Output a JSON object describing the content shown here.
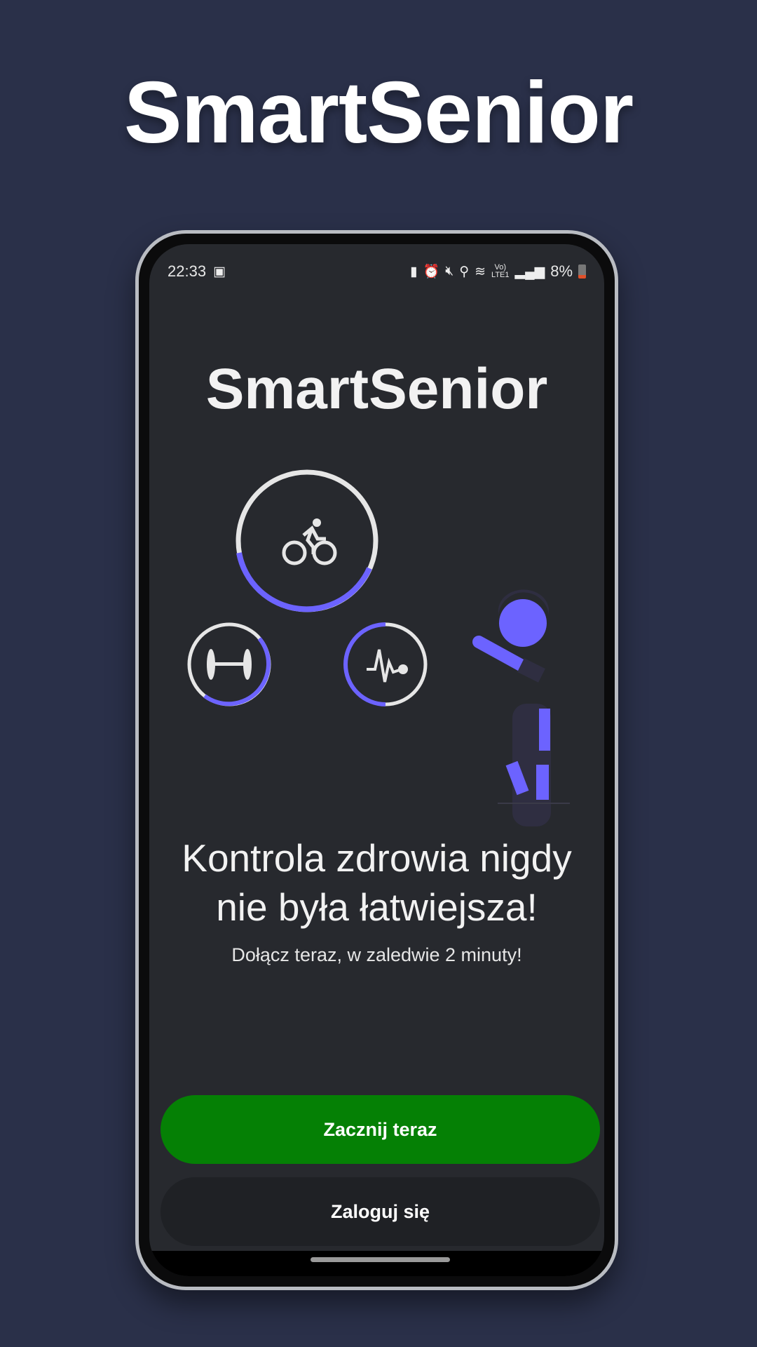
{
  "promo": {
    "title": "SmartSenior"
  },
  "status_bar": {
    "time": "22:33",
    "battery": "8%",
    "network": "LTE1",
    "icons": [
      "gallery-icon",
      "battery-saver-icon",
      "alarm-icon",
      "mute-icon",
      "location-icon",
      "wifi-icon",
      "volte-icon",
      "signal-icon",
      "battery-icon"
    ]
  },
  "app": {
    "title": "SmartSenior",
    "illustration": {
      "accent": "#6c63ff",
      "rings": [
        {
          "icon": "cycling-icon",
          "progress": 0.4
        },
        {
          "icon": "dumbbell-icon",
          "progress": 0.4
        },
        {
          "icon": "heartbeat-icon",
          "progress": 0.5
        }
      ]
    },
    "headline_line1": "Kontrola zdrowia nigdy",
    "headline_line2": "nie była łatwiejsza!",
    "subtitle": "Dołącz teraz, w zaledwie 2 minuty!",
    "start_button": "Zacznij teraz",
    "login_button": "Zaloguj się",
    "colors": {
      "start": "#058005",
      "login": "#1f2125",
      "background": "#27292e"
    }
  }
}
